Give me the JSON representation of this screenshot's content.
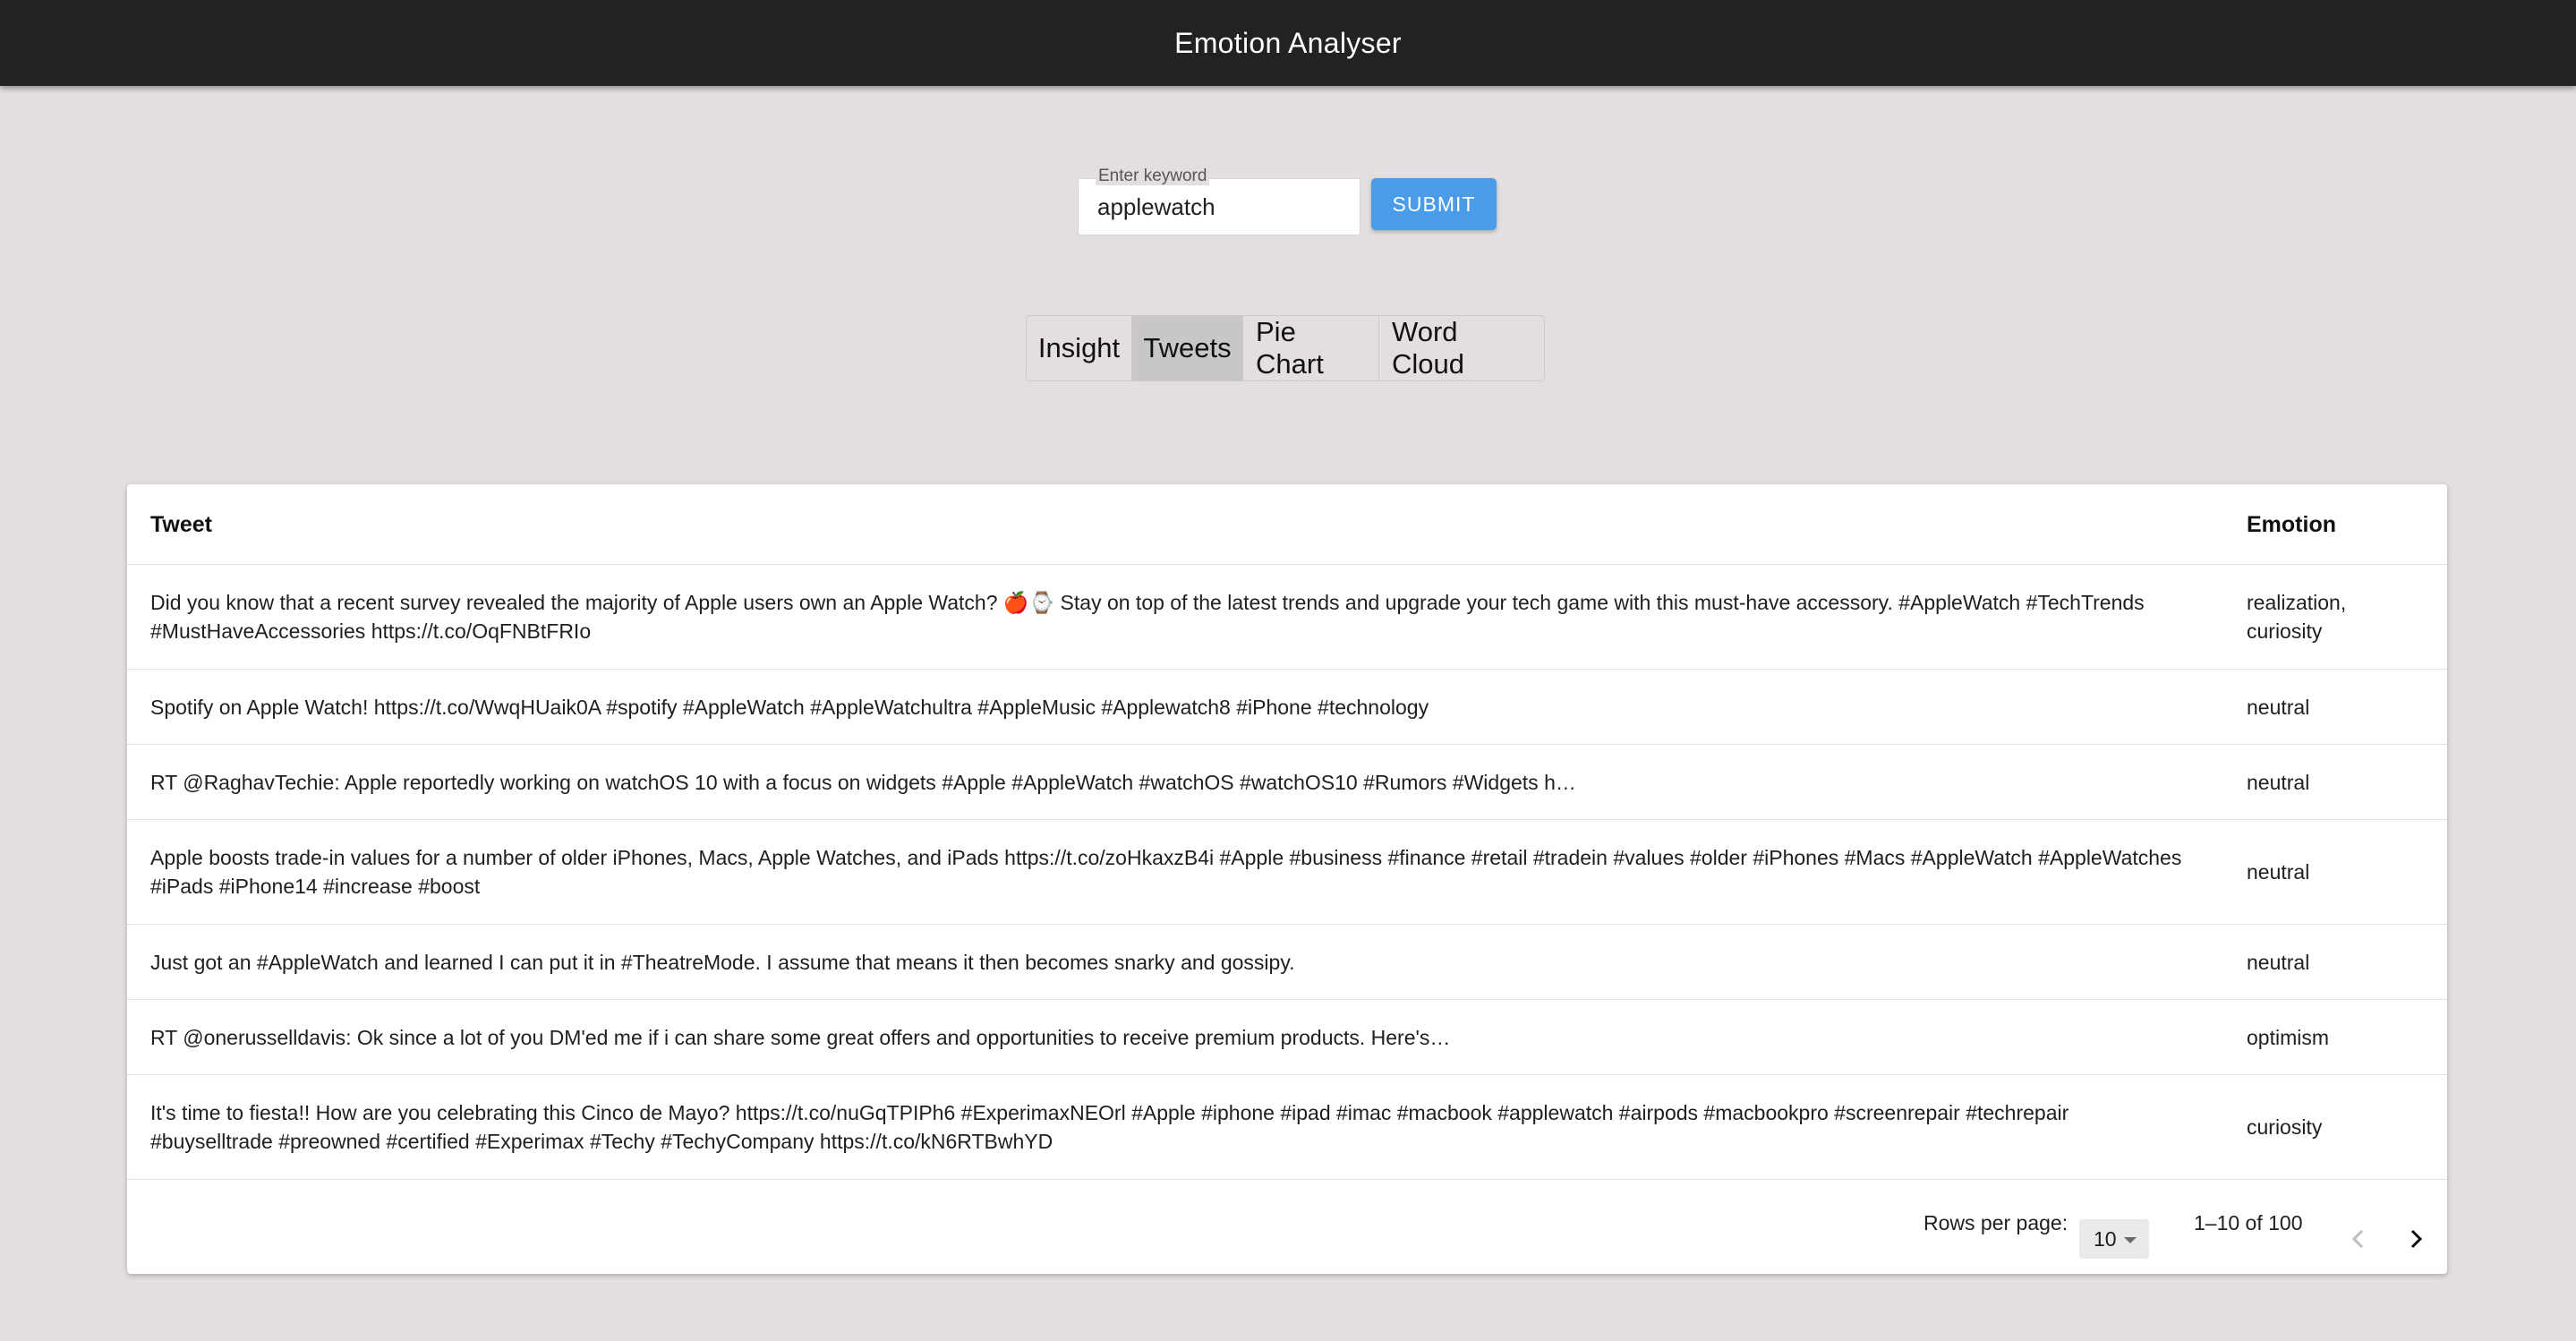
{
  "appbar": {
    "title": "Emotion Analyser"
  },
  "search": {
    "label": "Enter keyword",
    "value": "applewatch",
    "submit_label": "SUBMIT",
    "submit_color": "#4a9be8"
  },
  "tabs": [
    {
      "label": "Insight",
      "active": false
    },
    {
      "label": "Tweets",
      "active": true
    },
    {
      "label": "Pie Chart",
      "active": false
    },
    {
      "label": "Word Cloud",
      "active": false
    }
  ],
  "table": {
    "columns": [
      "Tweet",
      "Emotion"
    ],
    "rows": [
      {
        "tweet": "Did you know that a recent survey revealed the majority of Apple users own an Apple Watch? 🍎⌚ Stay on top of the latest trends and upgrade your tech game with this must-have accessory. #AppleWatch #TechTrends #MustHaveAccessories https://t.co/OqFNBtFRIo",
        "emotion": "realization, curiosity"
      },
      {
        "tweet": "Spotify on Apple Watch! https://t.co/WwqHUaik0A #spotify #AppleWatch #AppleWatchultra #AppleMusic  #Applewatch8 #iPhone #technology",
        "emotion": "neutral"
      },
      {
        "tweet": "RT @RaghavTechie: Apple reportedly working on watchOS 10 with a focus on widgets #Apple #AppleWatch #watchOS #watchOS10 #Rumors #Widgets h…",
        "emotion": "neutral"
      },
      {
        "tweet": "Apple boosts trade-in values for a number of older iPhones, Macs, Apple Watches, and iPads https://t.co/zoHkaxzB4i #Apple #business #finance #retail #tradein #values #older #iPhones #Macs #AppleWatch #AppleWatches #iPads #iPhone14 #increase #boost",
        "emotion": "neutral"
      },
      {
        "tweet": "Just got an #AppleWatch and learned I can put it in #TheatreMode. I assume that means it then becomes snarky and gossipy.",
        "emotion": "neutral"
      },
      {
        "tweet": "RT @onerusselldavis: Ok since a lot of you DM'ed me if i can share some great offers and opportunities to receive premium products. Here's…",
        "emotion": "optimism"
      },
      {
        "tweet": "It's time to fiesta!! How are you celebrating this Cinco de Mayo? https://t.co/nuGqTPIPh6 #ExperimaxNEOrl #Apple #iphone #ipad #imac #macbook #applewatch #airpods #macbookpro #screenrepair #techrepair #buyselltrade #preowned #certified #Experimax #Techy #TechyCompany https://t.co/kN6RTBwhYD",
        "emotion": "curiosity"
      }
    ]
  },
  "pagination": {
    "rows_per_page_label": "Rows per page:",
    "rows_per_page_value": "10",
    "range": "1–10 of 100",
    "prev_icon": "chevron-left-icon",
    "next_icon": "chevron-right-icon"
  }
}
